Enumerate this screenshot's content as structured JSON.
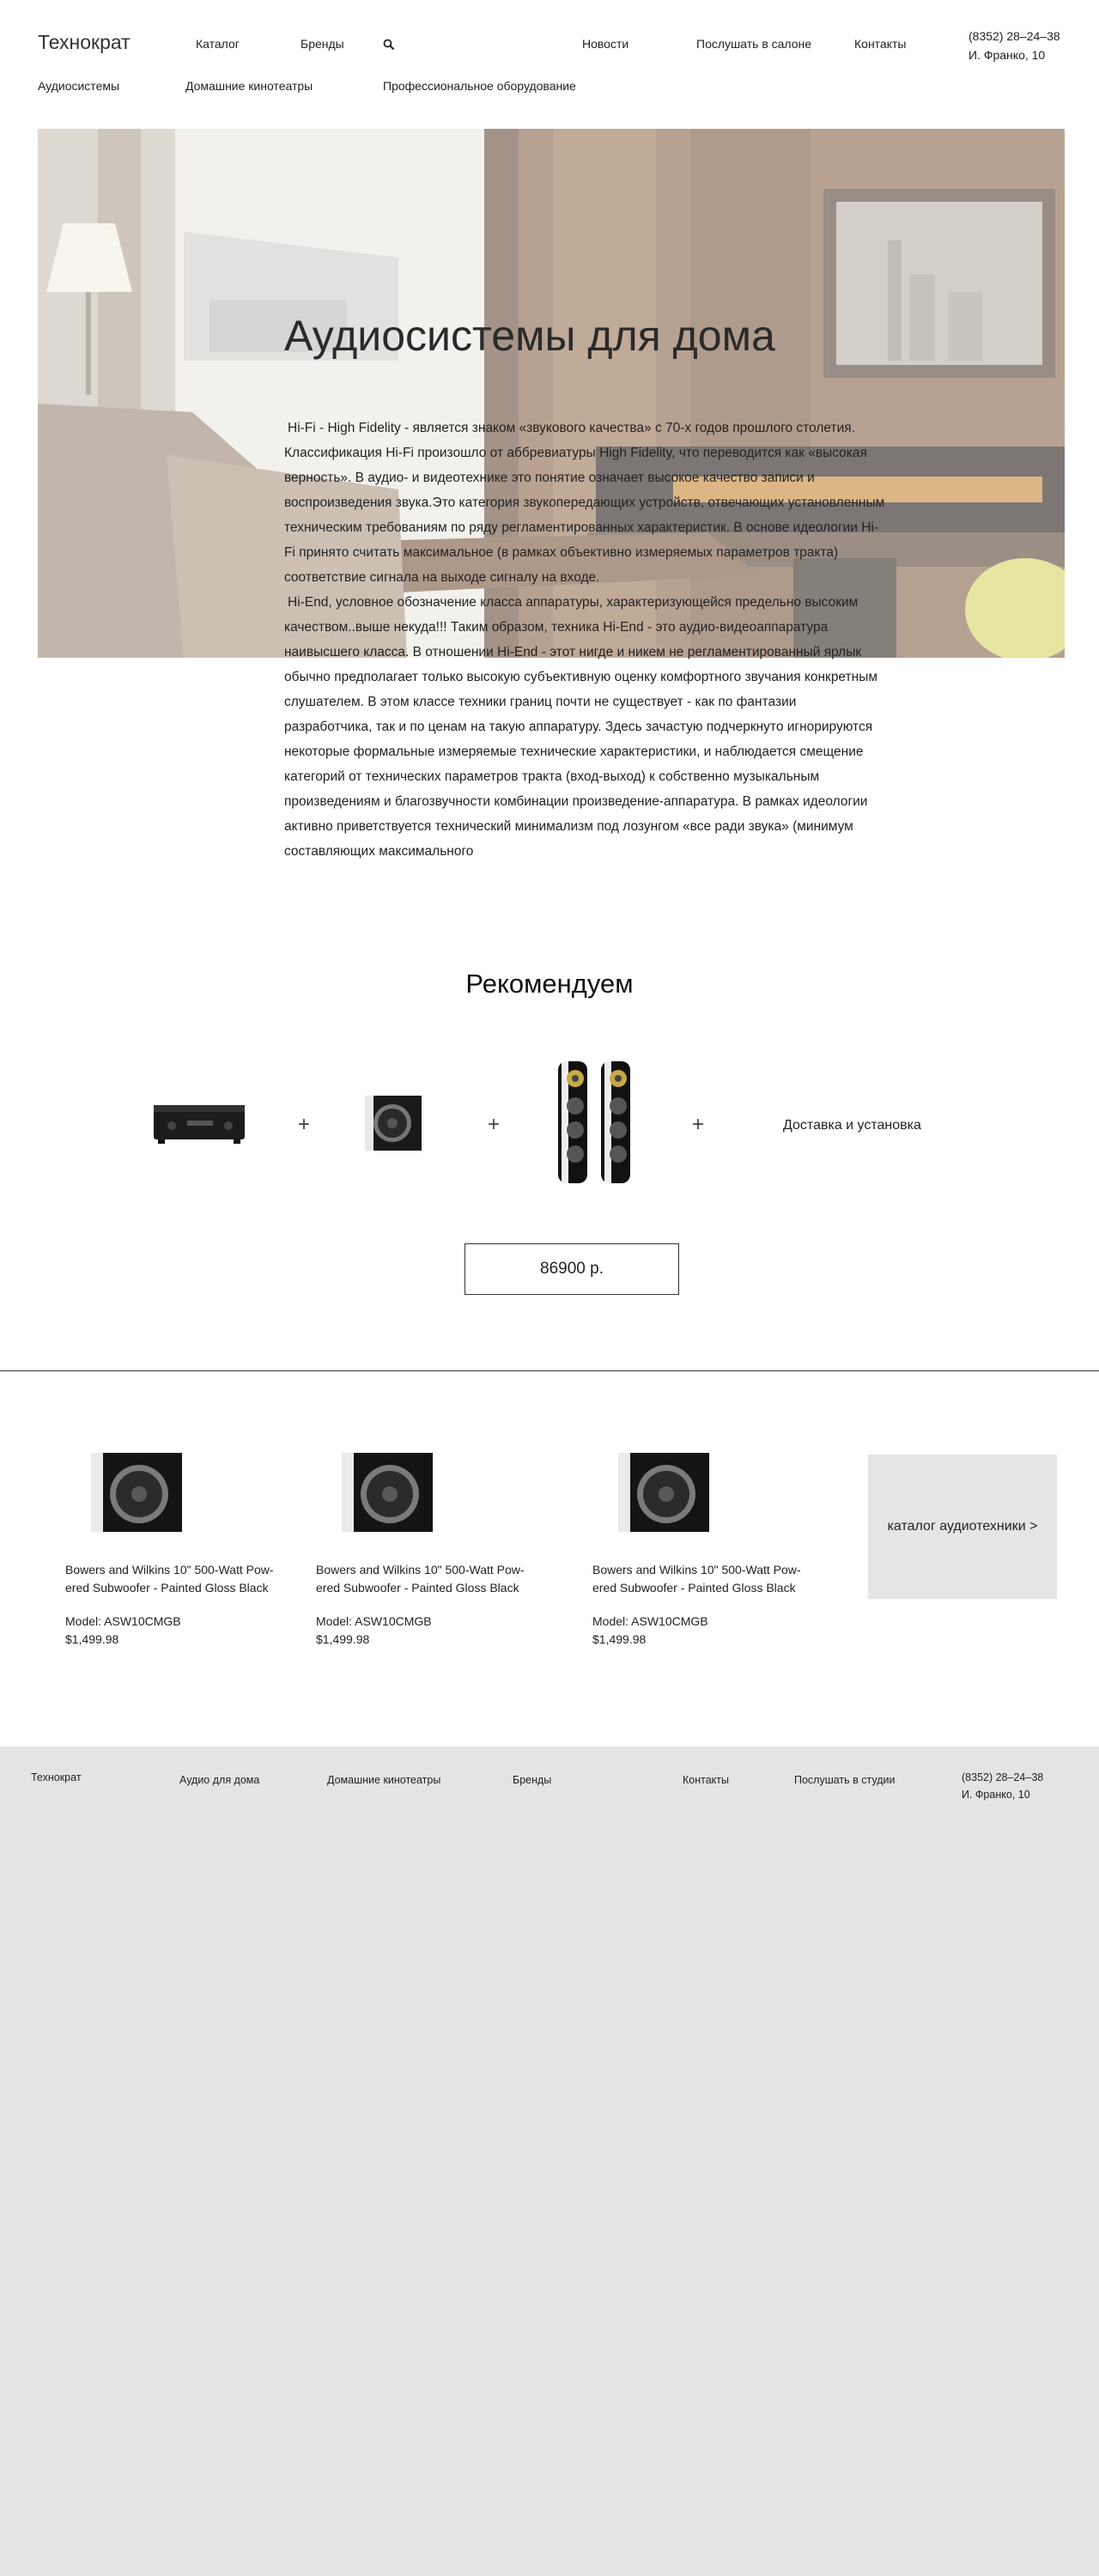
{
  "header": {
    "logo": "Технократ",
    "nav": {
      "catalog": "Каталог",
      "brands": "Бренды",
      "news": "Новости",
      "listen": "Послушать в салоне",
      "contacts": "Контакты"
    },
    "phone": "(8352) 28–24–38",
    "address": "И. Франко, 10",
    "subnav": [
      "Аудиосистемы",
      "Домашние кинотеатры",
      "Профессиональное оборудование"
    ]
  },
  "hero": {
    "title": "Аудиосистемы для дома",
    "paragraphs": [
      "Hi-Fi - High Fidelity - является знаком «звукового качества» с 70-х годов прошлого столетия. Классификация Hi-Fi произошло от аббревиатуры High Fidelity, что переводится как «высокая верность». В аудио- и видеотехнике это понятие означает высокое качество записи и воспроизведения звука.Это категория звукопередающих устройств, отвечающих установленным техническим требованиям по ряду регламентированных характеристик. В основе идеологии Hi-Fi принято считать максимальное (в рамках объективно измеряемых параметров тракта) соответствие сигнала на выходе сигналу на входе.",
      "Hi-End, условное обозначение класса аппаратуры, характеризующейся предельно высоким качеством..выше некуда!!! Таким образом, техника Hi-End - это аудио-видеоаппаратура наивысшего класса. В отношении Hi-End - этот нигде и никем не регламентированный ярлык обычно предполагает только высокую субъективную оценку комфортного звучания конкретным слушателем. В этом классе техники границ почти не существует - как по фантазии разработчика, так и по ценам на такую аппаратуру. Здесь зачастую подчеркнуто игнорируются некоторые формальные измеряемые технические характеристики, и наблюдается смещение категорий от технических параметров тракта (вход-выход) к собственно музыкальным произведениям и благозвучности комбинации произведение-аппаратура. В рамках идеологии активно приветствуется технический минимализм под лозунгом «все ради звука» (минимум составляющих максимального"
    ]
  },
  "recommend": {
    "title": "Рекомендуем",
    "plus": "+",
    "delivery": "Доставка и установка",
    "price": "86900 р."
  },
  "products": [
    {
      "name": "Bowers and Wilkins 10\" 500-Watt Pow-ered Subwoofer - Painted Gloss Black",
      "model": "Model: ASW10CMGB",
      "price": "$1,499.98"
    },
    {
      "name": "Bowers and Wilkins 10\" 500-Watt Pow-ered Subwoofer - Painted Gloss Black",
      "model": "Model: ASW10CMGB",
      "price": "$1,499.98"
    },
    {
      "name": "Bowers and Wilkins 10\" 500-Watt Pow-ered Subwoofer - Painted Gloss Black",
      "model": "Model: ASW10CMGB",
      "price": "$1,499.98"
    }
  ],
  "catalog_link": "каталог аудиотехники >",
  "footer": {
    "logo": "Технократ",
    "links": [
      "Аудио для дома",
      "Домашние кинотеатры",
      "Бренды",
      "Контакты",
      "Послушать в студии"
    ],
    "phone": "(8352) 28–24–38",
    "address": "И. Франко, 10"
  },
  "icons": {
    "search": "search-icon",
    "amplifier": "amplifier-icon",
    "subwoofer": "subwoofer-icon",
    "speakers": "floor-speakers-icon"
  }
}
